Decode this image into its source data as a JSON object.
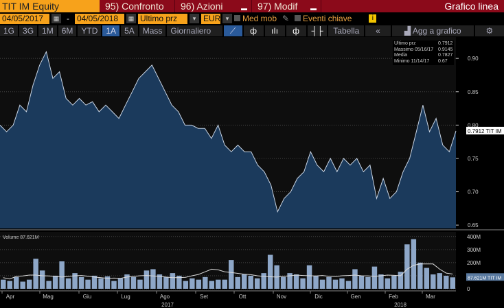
{
  "header": {
    "ticker": "TIT IM Equity",
    "buttons": [
      "95) Confronto",
      "96) Azioni",
      "97) Modif"
    ],
    "title": "Grafico linea"
  },
  "controls": {
    "start_date": "04/05/2017",
    "dash": "-",
    "end_date": "04/05/2018",
    "field": "Ultimo prz",
    "currency": "EUR",
    "med_mob": "Med mob",
    "eventi": "Eventi chiave",
    "info": "i"
  },
  "toolbar": {
    "periods": [
      "1G",
      "3G",
      "1M",
      "6M",
      "YTD",
      "1A",
      "5A",
      "Mass"
    ],
    "selected": "1A",
    "frequency": "Giornaliero ▼",
    "tabella": "Tabella",
    "collapse": "«",
    "add": "Agg a grafico",
    "settings": "⚙"
  },
  "colors": {
    "accent": "#f7a21b",
    "header": "#8b0a1a",
    "fill": "#1b3a5c",
    "line": "#c8d4e4",
    "volume": "#8ea7c8"
  },
  "chart_data": [
    {
      "type": "area",
      "title": "TIT IM price",
      "ylim": [
        0.645,
        0.93
      ],
      "yticks": [
        "0.90",
        "0.85",
        "0.80",
        "0.75",
        "0.70",
        "0.65"
      ],
      "ytick_values": [
        0.9,
        0.85,
        0.8,
        0.75,
        0.7,
        0.65
      ],
      "values": [
        0.8,
        0.79,
        0.8,
        0.83,
        0.82,
        0.86,
        0.89,
        0.91,
        0.87,
        0.88,
        0.84,
        0.83,
        0.84,
        0.83,
        0.835,
        0.82,
        0.83,
        0.82,
        0.81,
        0.83,
        0.85,
        0.87,
        0.88,
        0.89,
        0.87,
        0.85,
        0.83,
        0.82,
        0.8,
        0.8,
        0.795,
        0.795,
        0.78,
        0.8,
        0.77,
        0.76,
        0.77,
        0.76,
        0.76,
        0.74,
        0.73,
        0.71,
        0.67,
        0.69,
        0.7,
        0.72,
        0.73,
        0.76,
        0.74,
        0.73,
        0.75,
        0.73,
        0.75,
        0.74,
        0.75,
        0.73,
        0.74,
        0.69,
        0.72,
        0.69,
        0.7,
        0.73,
        0.75,
        0.79,
        0.83,
        0.79,
        0.81,
        0.77,
        0.76,
        0.7912
      ],
      "legend": [
        {
          "label": "Ultimo prz",
          "value": "0.7912"
        },
        {
          "label": "Massimo 05/16/17",
          "value": "0.9145"
        },
        {
          "label": "Media",
          "value": "0.7827"
        },
        {
          "label": "Minimo 11/14/17",
          "value": "0.67"
        }
      ],
      "last_label": "0.7912 TIT IM"
    },
    {
      "type": "bar",
      "title": "Volume",
      "legend": "Volume 87.621M",
      "ylim": [
        0,
        420
      ],
      "yticks": [
        "400M",
        "300M",
        "200M",
        "100M",
        "0"
      ],
      "ytick_values": [
        400,
        300,
        200,
        100,
        0
      ],
      "values": [
        70,
        60,
        90,
        55,
        70,
        230,
        140,
        60,
        100,
        210,
        80,
        120,
        90,
        70,
        100,
        80,
        95,
        60,
        80,
        110,
        90,
        70,
        140,
        150,
        110,
        90,
        120,
        100,
        60,
        80,
        70,
        90,
        60,
        70,
        70,
        220,
        90,
        110,
        100,
        80,
        120,
        260,
        180,
        90,
        120,
        110,
        80,
        180,
        100,
        70,
        90,
        70,
        80,
        60,
        150,
        100,
        90,
        170,
        110,
        80,
        100,
        130,
        340,
        380,
        200,
        160,
        110,
        120,
        100,
        87.621
      ],
      "ma": [
        85,
        75,
        95,
        98,
        105,
        105,
        100,
        98,
        95,
        90,
        95,
        100,
        102,
        96,
        90,
        85,
        80,
        82,
        80,
        90,
        95,
        100,
        102,
        98,
        95,
        90,
        85,
        86,
        88,
        100,
        110,
        130,
        150,
        145,
        130,
        125,
        118,
        112,
        108,
        100,
        95,
        92,
        90,
        95,
        100,
        105,
        102,
        100,
        98,
        102,
        96,
        94,
        100,
        102,
        105,
        100,
        99,
        95,
        100,
        105,
        103,
        100,
        150,
        180,
        190,
        190,
        190,
        150,
        120,
        113
      ],
      "last_label": "87.621M TIT IM"
    }
  ],
  "xaxis": {
    "months": [
      "Apr",
      "Mag",
      "Giu",
      "Lug",
      "Ago",
      "Set",
      "Ott",
      "Nov",
      "Dic",
      "Gen",
      "Feb",
      "Mar"
    ],
    "years": [
      "2017",
      "2018"
    ]
  }
}
